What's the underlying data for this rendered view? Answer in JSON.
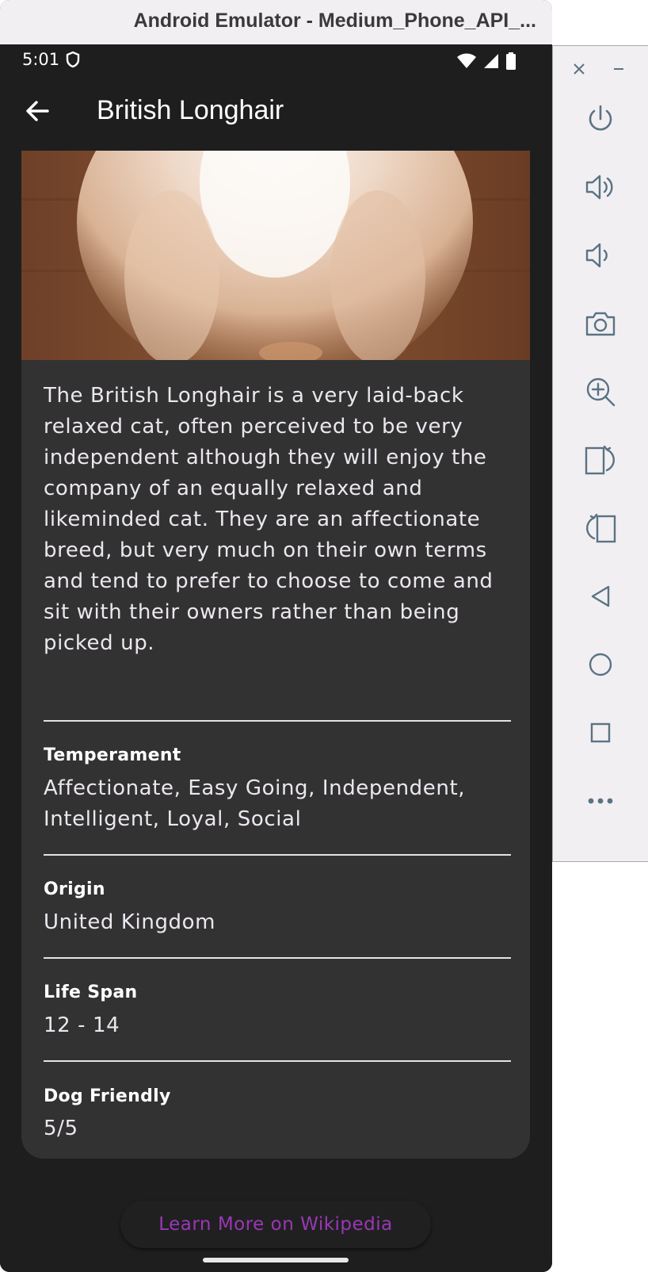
{
  "window": {
    "title": "Android Emulator - Medium_Phone_API_..."
  },
  "status_bar": {
    "time": "5:01"
  },
  "app_bar": {
    "title": "British Longhair",
    "back_icon": "arrow-back-icon"
  },
  "breed": {
    "image_alt": "British Longhair cat",
    "description": "The British Longhair is a very laid-back relaxed cat, often perceived to be very independent although they will enjoy the company of an equally relaxed and likeminded cat. They are an affectionate breed, but very much on their own terms and tend to prefer to choose to come and sit with their owners rather than being picked up.",
    "details": [
      {
        "label": "Temperament",
        "value": "Affectionate, Easy Going, Independent, Intelligent, Loyal, Social"
      },
      {
        "label": "Origin",
        "value": "United Kingdom"
      },
      {
        "label": "Life Span",
        "value": "12 - 14"
      },
      {
        "label": "Dog Friendly",
        "value": "5/5"
      }
    ]
  },
  "wiki_button": {
    "label": "Learn More on Wikipedia"
  },
  "side_toolbar": {
    "items": [
      "close-icon",
      "minimize-icon",
      "power-icon",
      "volume-up-icon",
      "volume-down-icon",
      "camera-icon",
      "zoom-icon",
      "rotate-left-icon",
      "rotate-right-icon",
      "back-triangle-icon",
      "home-circle-icon",
      "overview-square-icon",
      "more-icon"
    ]
  },
  "colors": {
    "screen_bg": "#1e1e1f",
    "card_bg": "#323233",
    "accent": "#9b37b6",
    "toolbar_bg": "#f2eff3",
    "toolbar_icon": "#5a7383"
  }
}
